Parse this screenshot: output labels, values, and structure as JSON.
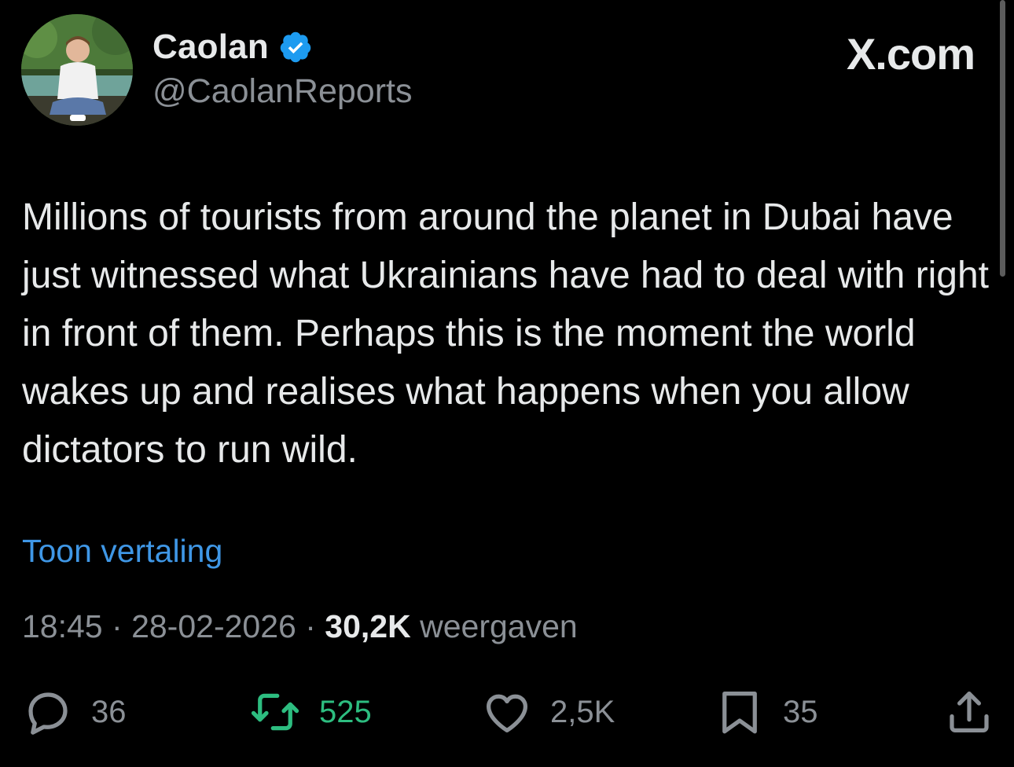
{
  "header": {
    "display_name": "Caolan",
    "handle": "@CaolanReports",
    "verified": true,
    "brand": "X.com",
    "avatar_icon": "profile-photo-icon"
  },
  "tweet": {
    "text": "Millions of tourists from around the planet in Dubai have just witnessed what Ukrainians have had to deal with right in front of them. Perhaps this is the moment the world wakes up and realises what happens when you allow dictators to run wild.",
    "translate_label": "Toon vertaling"
  },
  "meta": {
    "time": "18:45",
    "separator": "·",
    "date": "28-02-2026",
    "views_count": "30,2K",
    "views_label": "weergaven"
  },
  "actions": {
    "replies": "36",
    "reposts": "525",
    "likes": "2,5K",
    "bookmarks": "35"
  },
  "colors": {
    "background": "#000000",
    "text": "#e7e9ea",
    "secondary": "#8b9096",
    "link": "#3f97e6",
    "repost_active": "#2dbd80",
    "verified_badge": "#1d9bf0"
  }
}
